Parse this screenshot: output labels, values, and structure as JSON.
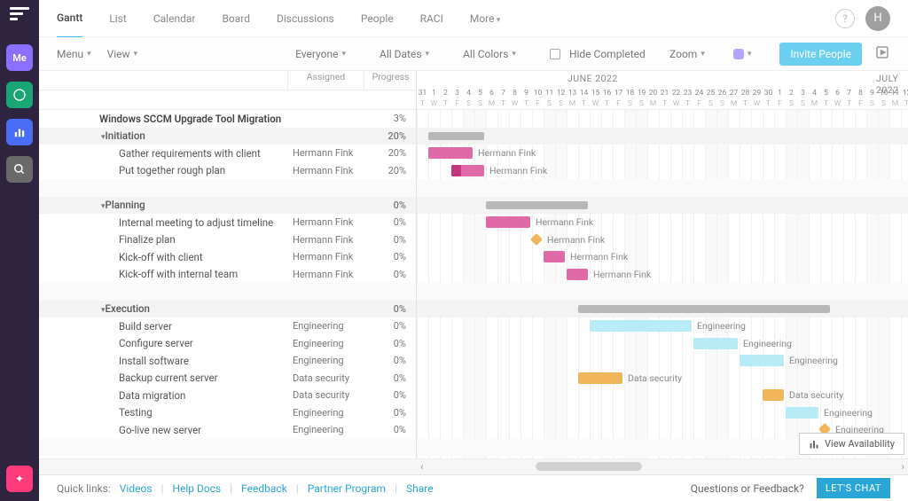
{
  "rail": {
    "me": "Me"
  },
  "tabs": {
    "items": [
      "Gantt",
      "List",
      "Calendar",
      "Board",
      "Discussions",
      "People",
      "RACI",
      "More"
    ],
    "active": 0,
    "avatar": "H"
  },
  "toolbar": {
    "menu": "Menu",
    "view": "View",
    "everyone": "Everyone",
    "alldates": "All Dates",
    "allcolors": "All Colors",
    "hidecompleted": "Hide Completed",
    "zoom": "Zoom",
    "invite": "Invite People"
  },
  "columns": {
    "assigned": "Assigned",
    "progress": "Progress"
  },
  "timeline": {
    "month1": "JUNE 2022",
    "month2": "JULY 2022"
  },
  "project": {
    "title": "Windows SCCM Upgrade Tool Migration",
    "progress": "3%"
  },
  "groups": [
    {
      "name": "Initiation",
      "progress": "20%",
      "tasks": [
        {
          "name": "Gather requirements with client",
          "assigned": "Hermann Fink",
          "progress": "20%",
          "barlabel": "Hermann Fink"
        },
        {
          "name": "Put together rough plan",
          "assigned": "Hermann Fink",
          "progress": "20%",
          "barlabel": "Hermann Fink"
        }
      ]
    },
    {
      "name": "Planning",
      "progress": "0%",
      "tasks": [
        {
          "name": "Internal meeting to adjust timeline",
          "assigned": "Hermann Fink",
          "progress": "0%",
          "barlabel": "Hermann Fink"
        },
        {
          "name": "Finalize plan",
          "assigned": "Hermann Fink",
          "progress": "0%",
          "barlabel": "Hermann Fink"
        },
        {
          "name": "Kick-off with client",
          "assigned": "Hermann Fink",
          "progress": "0%",
          "barlabel": "Hermann Fink"
        },
        {
          "name": "Kick-off with internal team",
          "assigned": "Hermann Fink",
          "progress": "0%",
          "barlabel": "Hermann Fink"
        }
      ]
    },
    {
      "name": "Execution",
      "progress": "0%",
      "tasks": [
        {
          "name": "Build server",
          "assigned": "Engineering",
          "progress": "0%",
          "barlabel": "Engineering"
        },
        {
          "name": "Configure server",
          "assigned": "Engineering",
          "progress": "0%",
          "barlabel": "Engineering"
        },
        {
          "name": "Install software",
          "assigned": "Engineering",
          "progress": "0%",
          "barlabel": "Engineering"
        },
        {
          "name": "Backup current server",
          "assigned": "Data security",
          "progress": "0%",
          "barlabel": "Data security"
        },
        {
          "name": "Data migration",
          "assigned": "Data security",
          "progress": "0%",
          "barlabel": "Data security"
        },
        {
          "name": "Testing",
          "assigned": "Engineering",
          "progress": "0%",
          "barlabel": "Engineering"
        },
        {
          "name": "Go-live new server",
          "assigned": "Engineering",
          "progress": "0%",
          "barlabel": "Engineering"
        }
      ]
    }
  ],
  "viewavail": "View Availability",
  "footer": {
    "quick": "Quick links:",
    "links": [
      "Videos",
      "Help Docs",
      "Feedback",
      "Partner Program",
      "Share"
    ],
    "question": "Questions or Feedback?",
    "chat": "LET'S CHAT"
  }
}
